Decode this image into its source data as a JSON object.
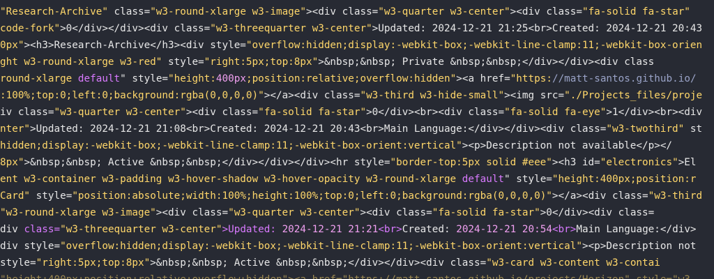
{
  "editor": {
    "background": "#272a33",
    "colors": {
      "text": "#e8e8e8",
      "string": "#ffd76a",
      "keyword": "#d97aff",
      "number": "#f0a0f0",
      "link": "#9aa3c7"
    },
    "lines": [
      [
        {
          "t": "\"Research-Archive\"",
          "c": "str"
        },
        {
          "t": " class=",
          "c": "default"
        },
        {
          "t": "\"w3-round-xlarge w3-image\"",
          "c": "str"
        },
        {
          "t": ">",
          "c": "default"
        },
        {
          "t": "<div class=",
          "c": "default"
        },
        {
          "t": "\"w3-quarter w3-center\"",
          "c": "str"
        },
        {
          "t": "><div class=",
          "c": "default"
        },
        {
          "t": "\"fa-solid fa-star\"",
          "c": "str"
        }
      ],
      [
        {
          "t": "code-fork\"",
          "c": "str"
        },
        {
          "t": ">0</div></div><div class=",
          "c": "default"
        },
        {
          "t": "\"w3-threequarter w3-center\"",
          "c": "str"
        },
        {
          "t": ">Updated: 2024-12-21 21:25<br>Created: 2024-12-21 20:43",
          "c": "default"
        }
      ],
      [
        {
          "t": "0px\"",
          "c": "str"
        },
        {
          "t": "><h3>Research-Archive</h3><div style=",
          "c": "default"
        },
        {
          "t": "\"overflow:hidden;display:-webkit-box;-webkit-line-clamp:11;-webkit-box-orien",
          "c": "str"
        }
      ],
      [
        {
          "t": "ght w3-round-xlarge w3-red\"",
          "c": "str"
        },
        {
          "t": " style=",
          "c": "default"
        },
        {
          "t": "\"right:5px;top:8px\"",
          "c": "str"
        },
        {
          "t": ">&nbsp;&nbsp; Private &nbsp;&nbsp;</div></div><div class",
          "c": "default"
        }
      ],
      [
        {
          "t": "round-xlarge ",
          "c": "str"
        },
        {
          "t": "default",
          "c": "kw"
        },
        {
          "t": "\" style=",
          "c": "default"
        },
        {
          "t": "\"height:",
          "c": "str"
        },
        {
          "t": "400px",
          "c": "num"
        },
        {
          "t": ";position:relative;overflow:hidden\"",
          "c": "str"
        },
        {
          "t": "><a href=",
          "c": "default"
        },
        {
          "t": "\"https:",
          "c": "str"
        },
        {
          "t": "//matt-santos.github.io/",
          "c": "link"
        }
      ],
      [
        {
          "t": ":100%;top:0;left:0;background:rgba(0,0,0,0)\"",
          "c": "str"
        },
        {
          "t": "></a><div class=",
          "c": "default"
        },
        {
          "t": "\"w3-third w3-hide-small\"",
          "c": "str"
        },
        {
          "t": "><img src=",
          "c": "default"
        },
        {
          "t": "\"./Projects_files/proje",
          "c": "str"
        }
      ],
      [
        {
          "t": "iv class=",
          "c": "default"
        },
        {
          "t": "\"w3-quarter w3-center\"",
          "c": "str"
        },
        {
          "t": "><div class=",
          "c": "default"
        },
        {
          "t": "\"fa-solid fa-star\"",
          "c": "str"
        },
        {
          "t": ">0</div><br><div class=",
          "c": "default"
        },
        {
          "t": "\"fa-solid fa-eye\"",
          "c": "str"
        },
        {
          "t": ">1</div><br><div",
          "c": "default"
        }
      ],
      [
        {
          "t": "nter\"",
          "c": "str"
        },
        {
          "t": ">Updated: 2024-12-21 21:08<br>Created: 2024-12-21 20:43<br>Main Language:</div></div><div class=",
          "c": "default"
        },
        {
          "t": "\"w3-twothird\"",
          "c": "str"
        },
        {
          "t": " st",
          "c": "default"
        }
      ],
      [
        {
          "t": "hidden;display:-webkit-box;-webkit-line-clamp:11;-webkit-box-orient:vertical\"",
          "c": "str"
        },
        {
          "t": "><p>Description not available</p></",
          "c": "default"
        }
      ],
      [
        {
          "t": "8px\"",
          "c": "str"
        },
        {
          "t": ">&nbsp;&nbsp; Active &nbsp;&nbsp;</div></div></div><hr style=",
          "c": "default"
        },
        {
          "t": "\"border-top:5px solid #eee\"",
          "c": "str"
        },
        {
          "t": "><h3 id=",
          "c": "default"
        },
        {
          "t": "\"electronics\"",
          "c": "str"
        },
        {
          "t": ">El",
          "c": "default"
        }
      ],
      [
        {
          "t": "ent w3-container w3-padding w3-hover-shadow w3-hover-opacity w3-round-xlarge ",
          "c": "str"
        },
        {
          "t": "default",
          "c": "kw"
        },
        {
          "t": "\" style=",
          "c": "default"
        },
        {
          "t": "\"height:400px;position:r",
          "c": "str"
        }
      ],
      [
        {
          "t": "Card\"",
          "c": "str"
        },
        {
          "t": " style=",
          "c": "default"
        },
        {
          "t": "\"position:absolute;width:100%;height:100%;top:0;left:0;background:rgba(0,0,0,0)\"",
          "c": "str"
        },
        {
          "t": "></a><div class=",
          "c": "default"
        },
        {
          "t": "\"w3-third",
          "c": "str"
        }
      ],
      [
        {
          "t": "\"w3-round-xlarge w3-image\"",
          "c": "str"
        },
        {
          "t": "><div class=",
          "c": "default"
        },
        {
          "t": "\"w3-quarter w3-center\"",
          "c": "str"
        },
        {
          "t": "><div class=",
          "c": "default"
        },
        {
          "t": "\"fa-solid fa-star\"",
          "c": "str"
        },
        {
          "t": ">0</div><div class=",
          "c": "default"
        }
      ],
      [
        {
          "t": "div ",
          "c": "default"
        },
        {
          "t": "class=",
          "c": "kw"
        },
        {
          "t": "\"w3-threequarter w3-center\"",
          "c": "str"
        },
        {
          "t": ">Updated: ",
          "c": "kw"
        },
        {
          "t": "2024-12-21 21:21",
          "c": "num"
        },
        {
          "t": "<br>",
          "c": "kw"
        },
        {
          "t": "Created: ",
          "c": "default"
        },
        {
          "t": "2024-12-21 20:54",
          "c": "num"
        },
        {
          "t": "<br>",
          "c": "kw"
        },
        {
          "t": "Main Language:</div>",
          "c": "default"
        }
      ],
      [
        {
          "t": "div style=",
          "c": "default"
        },
        {
          "t": "\"overflow:hidden;display:-webkit-box;-webkit-line-clamp:11;-webkit-box-orient:vertical\"",
          "c": "str"
        },
        {
          "t": "><p>Description not",
          "c": "default"
        }
      ],
      [
        {
          "t": "style=",
          "c": "default"
        },
        {
          "t": "\"right:5px;top:8px\"",
          "c": "str"
        },
        {
          "t": ">&nbsp;&nbsp; Active &nbsp;&nbsp;</div></div><div class=",
          "c": "default"
        },
        {
          "t": "\"w3-card w3-content w3-contai",
          "c": "str"
        }
      ],
      [
        {
          "t": "\"height:400px;position:relative;overflow:hidden\"><a href=\"https://matt-santos.github.io/projects/Horizon\" style=\"w3-",
          "c": "str"
        }
      ]
    ]
  }
}
